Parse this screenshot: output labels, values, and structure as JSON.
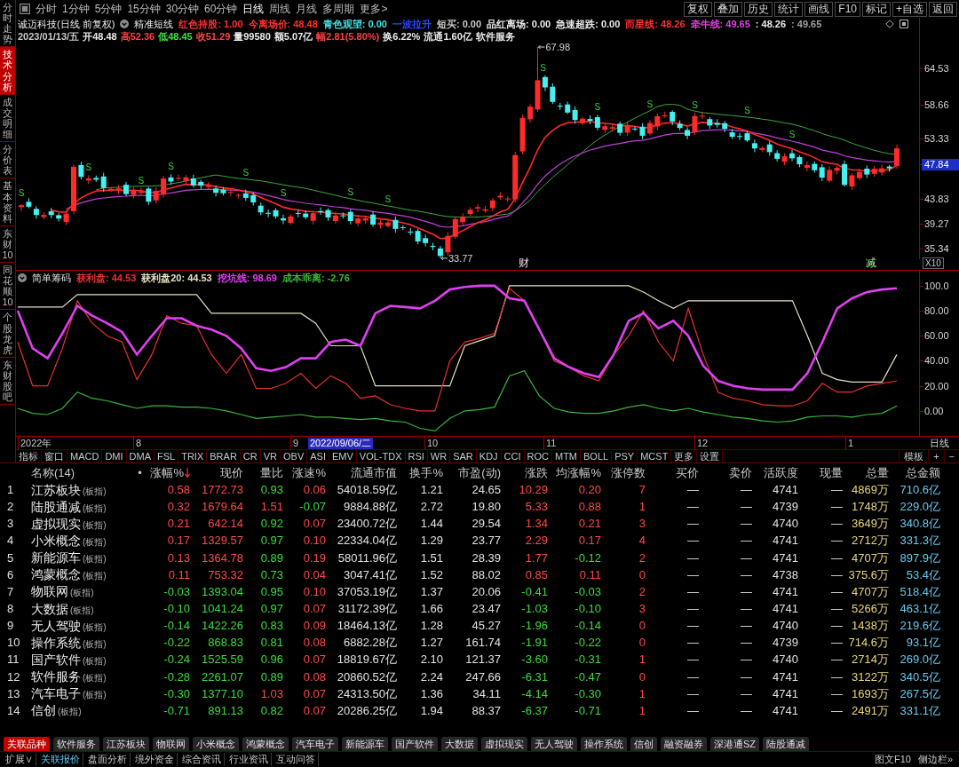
{
  "sidebar": {
    "tabs": [
      {
        "label": "分时走势",
        "selected": false
      },
      {
        "label": "技术分析",
        "selected": true
      },
      {
        "label": "成交明细",
        "selected": false
      },
      {
        "label": "分价表",
        "selected": false
      },
      {
        "label": "基本资料",
        "selected": false
      },
      {
        "label": "东财10",
        "selected": false
      },
      {
        "label": "同花顺10",
        "selected": false
      },
      {
        "label": "个股龙虎",
        "selected": false
      },
      {
        "label": "东财股吧",
        "selected": false
      }
    ]
  },
  "toolbar": {
    "periods": [
      {
        "label": "分时",
        "selected": false
      },
      {
        "label": "1分钟",
        "selected": false
      },
      {
        "label": "5分钟",
        "selected": false
      },
      {
        "label": "15分钟",
        "selected": false
      },
      {
        "label": "30分钟",
        "selected": false
      },
      {
        "label": "60分钟",
        "selected": false
      },
      {
        "label": "日线",
        "selected": true
      },
      {
        "label": "周线",
        "selected": false
      },
      {
        "label": "月线",
        "selected": false
      },
      {
        "label": "多周期",
        "selected": false
      },
      {
        "label": "更多>",
        "selected": false
      }
    ],
    "actions": [
      "复权",
      "叠加",
      "历史",
      "统计",
      "画线",
      "F10",
      "标记",
      "+自选",
      "返回"
    ]
  },
  "chart": {
    "title": "诚迈科技(日线 前复权)",
    "formula": "精准短线",
    "readouts": [
      {
        "text": "红色持股: 1.00",
        "color": "#ff3030"
      },
      {
        "text": "今离场价: 48.48",
        "color": "#ff3030"
      },
      {
        "text": "青色观望: 0.00",
        "color": "#40e0e0"
      },
      {
        "text": "一波拉升",
        "color": "#2848ff"
      },
      {
        "text": "短买: 0.00",
        "color": "#c8c8c8"
      },
      {
        "text": "品红离场: 0.00",
        "color": "#e8e8e8"
      },
      {
        "text": "急速超跌: 0.00",
        "color": "#e8e8e8"
      },
      {
        "text": "而星线: 48.26",
        "color": "#ff3030"
      },
      {
        "text": "牵牛线: 49.65",
        "color": "#e040e0"
      },
      {
        "text": ": 48.26",
        "color": "#e8e8e8"
      },
      {
        "text": ": 49.65",
        "color": "#a0a0a0"
      }
    ],
    "quote": [
      {
        "text": "2023/01/13/五",
        "color": "#c8c8c8"
      },
      {
        "text": "开48.48",
        "color": "#e8e8e8"
      },
      {
        "text": "高52.36",
        "color": "#ff4040"
      },
      {
        "text": "低48.45",
        "color": "#40e040"
      },
      {
        "text": "收51.29",
        "color": "#ff4040"
      },
      {
        "text": "量99580",
        "color": "#e8e8e8"
      },
      {
        "text": "额5.07亿",
        "color": "#e8e8e8"
      },
      {
        "text": "幅2.81(5.80%)",
        "color": "#ff4040"
      },
      {
        "text": "换6.22%",
        "color": "#e8e8e8"
      },
      {
        "text": "流通1.60亿",
        "color": "#e8e8e8"
      },
      {
        "text": "软件服务",
        "color": "#e8e8e8"
      }
    ],
    "price_axis": [
      {
        "label": "64.53",
        "current": false
      },
      {
        "label": "58.66",
        "current": false
      },
      {
        "label": "53.33",
        "current": false
      },
      {
        "label": "47.84",
        "current": true
      },
      {
        "label": "43.83",
        "current": false
      },
      {
        "label": "39.27",
        "current": false
      },
      {
        "label": "35.34",
        "current": false
      }
    ],
    "high_label": "67.98",
    "low_label": "33.77",
    "signals": [
      "S",
      "S",
      "S",
      "S",
      "S",
      "S",
      "S",
      "S",
      "S",
      "S",
      "S",
      "S",
      "S",
      "S"
    ],
    "events": [
      {
        "text": "财",
        "kind": "report"
      },
      {
        "text": "减",
        "kind": "reduction"
      }
    ],
    "zoom": "X10"
  },
  "indicator": {
    "title": "简单筹码",
    "readings": [
      ": 44.53",
      ": 44.53",
      ": 98.69",
      ": -2.76"
    ],
    "chart_data": {
      "type": "line",
      "ylim": [
        -20,
        112
      ],
      "yticks": [
        {
          "value": 100,
          "label": "100.0"
        },
        {
          "value": 80,
          "label": "80.00"
        },
        {
          "value": 60,
          "label": "60.00"
        },
        {
          "value": 40,
          "label": "40.00"
        },
        {
          "value": 20,
          "label": "20.00"
        },
        {
          "value": 0,
          "label": "0.00"
        }
      ],
      "series": [
        {
          "name": "获利盘",
          "color": "#e83030",
          "values": [
            55,
            20,
            20,
            50,
            88,
            70,
            60,
            55,
            25,
            45,
            76,
            70,
            68,
            45,
            30,
            45,
            18,
            18,
            22,
            30,
            18,
            28,
            22,
            10,
            12,
            5,
            2,
            0,
            0,
            40,
            55,
            58,
            62,
            98,
            88,
            65,
            40,
            35,
            28,
            24,
            45,
            60,
            80,
            55,
            40,
            82,
            45,
            15,
            10,
            8,
            5,
            4,
            4,
            8,
            22,
            15,
            15,
            20,
            22,
            24
          ]
        },
        {
          "name": "获利盘20",
          "color": "#e6dfc0",
          "values": [
            83,
            83,
            83,
            83,
            93,
            93,
            93,
            93,
            93,
            93,
            93,
            93,
            93,
            78,
            78,
            78,
            78,
            78,
            78,
            78,
            70,
            52,
            52,
            52,
            20,
            20,
            20,
            20,
            20,
            20,
            52,
            56,
            60,
            100,
            100,
            100,
            100,
            100,
            100,
            100,
            100,
            100,
            95,
            88,
            82,
            88,
            88,
            88,
            88,
            88,
            88,
            88,
            88,
            60,
            30,
            25,
            23,
            23,
            23,
            45
          ]
        },
        {
          "name": "挖坑线",
          "color": "#e040f0",
          "values": [
            80,
            50,
            42,
            62,
            84,
            76,
            70,
            63,
            45,
            60,
            74,
            74,
            68,
            65,
            60,
            50,
            34,
            32,
            35,
            42,
            42,
            55,
            57,
            52,
            78,
            84,
            83,
            82,
            88,
            97,
            99,
            100,
            100,
            90,
            88,
            65,
            42,
            35,
            30,
            27,
            45,
            72,
            78,
            66,
            72,
            60,
            36,
            24,
            20,
            18,
            17,
            17,
            17,
            30,
            55,
            82,
            90,
            95,
            97,
            98
          ]
        },
        {
          "name": "成本乖离",
          "color": "#38b838",
          "values": [
            2,
            -2,
            -3,
            2,
            15,
            10,
            8,
            5,
            2,
            4,
            4,
            3,
            3,
            2,
            0,
            -3,
            -6,
            -5,
            -4,
            -3,
            -5,
            -5,
            -6,
            -7,
            -6,
            -8,
            -9,
            -14,
            -16,
            -6,
            0,
            1,
            3,
            28,
            32,
            12,
            2,
            -1,
            -2,
            -2,
            0,
            3,
            5,
            2,
            0,
            2,
            -1,
            -3,
            -5,
            -6,
            -8,
            -9,
            -8,
            -5,
            -4,
            -4,
            -5,
            -3,
            -2,
            4
          ]
        }
      ]
    }
  },
  "date_axis": {
    "labels": [
      "2022年",
      "8",
      "9",
      "10",
      "11",
      "12",
      "1"
    ],
    "cursor_date": "2022/09/06/二",
    "period": "日线"
  },
  "indicator_tabs": {
    "items": [
      "指标",
      "窗口",
      "MACD",
      "DMI",
      "DMA",
      "FSL",
      "TRIX",
      "BRAR",
      "CR",
      "VR",
      "OBV",
      "ASI",
      "EMV",
      "VOL-TDX",
      "RSI",
      "WR",
      "SAR",
      "KDJ",
      "CCI",
      "ROC",
      "MTM",
      "BOLL",
      "PSY",
      "MCST",
      "更多",
      "设置"
    ],
    "tools": [
      "模板",
      "+",
      "−"
    ]
  },
  "table": {
    "columns": [
      {
        "label": "名称(14)",
        "kind": "name",
        "sorted": false
      },
      {
        "label": "•",
        "kind": "dot",
        "sorted": false
      },
      {
        "label": "涨幅%",
        "kind": "rise",
        "sorted": true
      },
      {
        "label": "现价",
        "kind": "rise",
        "sorted": false
      },
      {
        "label": "量比",
        "kind": "ratio",
        "sorted": false
      },
      {
        "label": "涨速%",
        "kind": "speed",
        "sorted": false
      },
      {
        "label": "流通市值",
        "kind": "plain",
        "sorted": false
      },
      {
        "label": "换手%",
        "kind": "plain",
        "sorted": false
      },
      {
        "label": "市盈(动)",
        "kind": "plain",
        "sorted": false
      },
      {
        "label": "涨跌",
        "kind": "rise",
        "sorted": false
      },
      {
        "label": "均涨幅%",
        "kind": "avg",
        "sorted": false
      },
      {
        "label": "涨停数",
        "kind": "limit",
        "sorted": false
      },
      {
        "label": "买价",
        "kind": "plain",
        "sorted": false
      },
      {
        "label": "卖价",
        "kind": "plain",
        "sorted": false
      },
      {
        "label": "活跃度",
        "kind": "plain",
        "sorted": false
      },
      {
        "label": "现量",
        "kind": "plain",
        "sorted": false
      },
      {
        "label": "总量",
        "kind": "volume",
        "sorted": false
      },
      {
        "label": "总金额",
        "kind": "amount",
        "sorted": false
      }
    ],
    "rows": [
      {
        "no": "1",
        "name": "江苏板块",
        "tag": "(板指)",
        "values": [
          "0.58",
          "1772.73",
          "0.93",
          "0.06",
          "54018.59亿",
          "1.21",
          "24.65",
          "10.29",
          "0.20",
          "7",
          "—",
          "—",
          "4741",
          "—",
          "4869万",
          "710.6亿"
        ],
        "up": true,
        "avg_up": true,
        "ratio_up": false,
        "speed_up": true
      },
      {
        "no": "2",
        "name": "陆股通减",
        "tag": "(板指)",
        "values": [
          "0.32",
          "1679.64",
          "1.51",
          "-0.07",
          "9884.88亿",
          "2.72",
          "19.80",
          "5.33",
          "0.88",
          "1",
          "—",
          "—",
          "4739",
          "—",
          "1748万",
          "229.0亿"
        ],
        "up": true,
        "avg_up": true,
        "ratio_up": true,
        "speed_up": false
      },
      {
        "no": "3",
        "name": "虚拟现实",
        "tag": "(板指)",
        "values": [
          "0.21",
          "642.14",
          "0.92",
          "0.07",
          "23400.72亿",
          "1.44",
          "29.54",
          "1.34",
          "0.21",
          "3",
          "—",
          "—",
          "4740",
          "—",
          "3649万",
          "340.8亿"
        ],
        "up": true,
        "avg_up": true,
        "ratio_up": false,
        "speed_up": true
      },
      {
        "no": "4",
        "name": "小米概念",
        "tag": "(板指)",
        "values": [
          "0.17",
          "1329.57",
          "0.97",
          "0.10",
          "22334.04亿",
          "1.29",
          "23.77",
          "2.29",
          "0.17",
          "4",
          "—",
          "—",
          "4741",
          "—",
          "2712万",
          "331.3亿"
        ],
        "up": true,
        "avg_up": true,
        "ratio_up": false,
        "speed_up": true
      },
      {
        "no": "5",
        "name": "新能源车",
        "tag": "(板指)",
        "values": [
          "0.13",
          "1364.78",
          "0.89",
          "0.19",
          "58011.96亿",
          "1.51",
          "28.39",
          "1.77",
          "-0.12",
          "2",
          "—",
          "—",
          "4741",
          "—",
          "4707万",
          "897.9亿"
        ],
        "up": true,
        "avg_up": false,
        "ratio_up": false,
        "speed_up": true
      },
      {
        "no": "6",
        "name": "鸿蒙概念",
        "tag": "(板指)",
        "values": [
          "0.11",
          "753.32",
          "0.73",
          "0.04",
          "3047.41亿",
          "1.52",
          "88.02",
          "0.85",
          "0.11",
          "0",
          "—",
          "—",
          "4738",
          "—",
          "375.6万",
          "53.4亿"
        ],
        "up": true,
        "avg_up": true,
        "ratio_up": false,
        "speed_up": true
      },
      {
        "no": "7",
        "name": "物联网",
        "tag": "(板指)",
        "values": [
          "-0.03",
          "1393.04",
          "0.95",
          "0.10",
          "37053.19亿",
          "1.37",
          "20.06",
          "-0.41",
          "-0.03",
          "2",
          "—",
          "—",
          "4741",
          "—",
          "4707万",
          "518.4亿"
        ],
        "up": false,
        "avg_up": false,
        "ratio_up": false,
        "speed_up": true
      },
      {
        "no": "8",
        "name": "大数据",
        "tag": "(板指)",
        "values": [
          "-0.10",
          "1041.24",
          "0.97",
          "0.07",
          "31172.39亿",
          "1.66",
          "23.47",
          "-1.03",
          "-0.10",
          "3",
          "—",
          "—",
          "4741",
          "—",
          "5266万",
          "463.1亿"
        ],
        "up": false,
        "avg_up": false,
        "ratio_up": false,
        "speed_up": true
      },
      {
        "no": "9",
        "name": "无人驾驶",
        "tag": "(板指)",
        "values": [
          "-0.14",
          "1422.26",
          "0.83",
          "0.09",
          "18464.13亿",
          "1.28",
          "45.27",
          "-1.96",
          "-0.14",
          "0",
          "—",
          "—",
          "4740",
          "—",
          "1438万",
          "219.6亿"
        ],
        "up": false,
        "avg_up": false,
        "ratio_up": false,
        "speed_up": true
      },
      {
        "no": "10",
        "name": "操作系统",
        "tag": "(板指)",
        "values": [
          "-0.22",
          "868.83",
          "0.81",
          "0.08",
          "6882.28亿",
          "1.27",
          "161.74",
          "-1.91",
          "-0.22",
          "0",
          "—",
          "—",
          "4739",
          "—",
          "714.6万",
          "93.1亿"
        ],
        "up": false,
        "avg_up": false,
        "ratio_up": false,
        "speed_up": true
      },
      {
        "no": "11",
        "name": "国产软件",
        "tag": "(板指)",
        "values": [
          "-0.24",
          "1525.59",
          "0.96",
          "0.07",
          "18819.67亿",
          "2.10",
          "121.37",
          "-3.60",
          "-0.31",
          "1",
          "—",
          "—",
          "4740",
          "—",
          "2714万",
          "269.0亿"
        ],
        "up": false,
        "avg_up": false,
        "ratio_up": false,
        "speed_up": true
      },
      {
        "no": "12",
        "name": "软件服务",
        "tag": "(板指)",
        "values": [
          "-0.28",
          "2261.07",
          "0.89",
          "0.08",
          "20860.52亿",
          "2.24",
          "247.66",
          "-6.31",
          "-0.47",
          "0",
          "—",
          "—",
          "4741",
          "—",
          "3122万",
          "340.5亿"
        ],
        "up": false,
        "avg_up": false,
        "ratio_up": false,
        "speed_up": true
      },
      {
        "no": "13",
        "name": "汽车电子",
        "tag": "(板指)",
        "values": [
          "-0.30",
          "1377.10",
          "1.03",
          "0.07",
          "24313.50亿",
          "1.36",
          "34.11",
          "-4.14",
          "-0.30",
          "1",
          "—",
          "—",
          "4741",
          "—",
          "1693万",
          "267.5亿"
        ],
        "up": false,
        "avg_up": false,
        "ratio_up": true,
        "speed_up": true
      },
      {
        "no": "14",
        "name": "信创",
        "tag": "(板指)",
        "values": [
          "-0.71",
          "891.13",
          "0.82",
          "0.07",
          "20286.25亿",
          "1.94",
          "88.37",
          "-6.37",
          "-0.71",
          "1",
          "—",
          "—",
          "4741",
          "—",
          "2491万",
          "331.1亿"
        ],
        "up": false,
        "avg_up": false,
        "ratio_up": false,
        "speed_up": true
      }
    ]
  },
  "related_tabs": [
    {
      "label": "关联品种",
      "selected": true
    },
    {
      "label": "软件服务",
      "selected": false
    },
    {
      "label": "江苏板块",
      "selected": false
    },
    {
      "label": "物联网",
      "selected": false
    },
    {
      "label": "小米概念",
      "selected": false
    },
    {
      "label": "鸿蒙概念",
      "selected": false
    },
    {
      "label": "汽车电子",
      "selected": false
    },
    {
      "label": "新能源车",
      "selected": false
    },
    {
      "label": "国产软件",
      "selected": false
    },
    {
      "label": "大数据",
      "selected": false
    },
    {
      "label": "虚拟现实",
      "selected": false
    },
    {
      "label": "无人驾驶",
      "selected": false
    },
    {
      "label": "操作系统",
      "selected": false
    },
    {
      "label": "信创",
      "selected": false
    },
    {
      "label": "融资融券",
      "selected": false
    },
    {
      "label": "深港通SZ",
      "selected": false
    },
    {
      "label": "陆股通减",
      "selected": false
    }
  ],
  "bottom_bar": {
    "items": [
      {
        "label": "扩展∨",
        "selected": false
      },
      {
        "label": "关联报价",
        "selected": true
      },
      {
        "label": "盘面分析",
        "selected": false
      },
      {
        "label": "境外资金",
        "selected": false
      },
      {
        "label": "综合资讯",
        "selected": false
      },
      {
        "label": "行业资讯",
        "selected": false
      },
      {
        "label": "互动问答",
        "selected": false
      }
    ],
    "right": [
      "图文F10",
      "侧边栏»"
    ]
  }
}
